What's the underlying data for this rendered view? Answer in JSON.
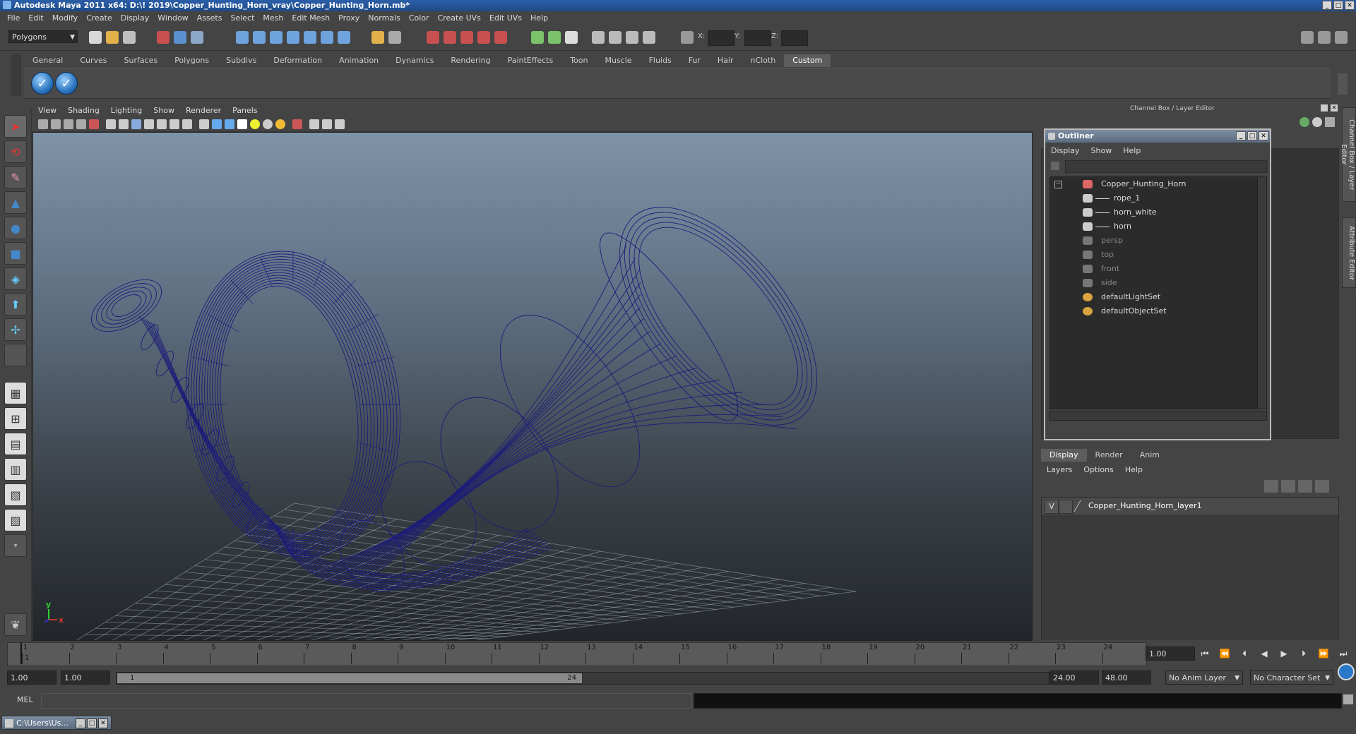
{
  "window": {
    "title": "Autodesk Maya 2011 x64: D:\\! 2019\\Copper_Hunting_Horn_vray\\Copper_Hunting_Horn.mb*",
    "buttons": [
      "_",
      "□",
      "✕"
    ]
  },
  "menubar": [
    "File",
    "Edit",
    "Modify",
    "Create",
    "Display",
    "Window",
    "Assets",
    "Select",
    "Mesh",
    "Edit Mesh",
    "Proxy",
    "Normals",
    "Color",
    "Create UVs",
    "Edit UVs",
    "Help"
  ],
  "statusline": {
    "mode": "Polygons",
    "coord_labels": [
      "X:",
      "Y:",
      "Z:"
    ]
  },
  "shelf": {
    "tabs": [
      "General",
      "Curves",
      "Surfaces",
      "Polygons",
      "Subdivs",
      "Deformation",
      "Animation",
      "Dynamics",
      "Rendering",
      "PaintEffects",
      "Toon",
      "Muscle",
      "Fluids",
      "Fur",
      "Hair",
      "nCloth",
      "Custom"
    ],
    "active_tab": "Custom"
  },
  "viewport": {
    "menu": [
      "View",
      "Shading",
      "Lighting",
      "Show",
      "Renderer",
      "Panels"
    ],
    "axis": {
      "y": "y",
      "x": "x"
    },
    "wire_color": "#1c1c7a",
    "grid_color": "#aab4c0"
  },
  "channel_box": {
    "title": "Channel Box / Layer Editor",
    "side_tabs": [
      "Channel Box / Layer Editor",
      "Attribute Editor"
    ]
  },
  "outliner": {
    "title": "Outliner",
    "menu": [
      "Display",
      "Show",
      "Help"
    ],
    "items": [
      {
        "label": "Copper_Hunting_Horn",
        "dim": false
      },
      {
        "label": "rope_1",
        "dim": false
      },
      {
        "label": "horn_white",
        "dim": false
      },
      {
        "label": "horn",
        "dim": false
      },
      {
        "label": "persp",
        "dim": true
      },
      {
        "label": "top",
        "dim": true
      },
      {
        "label": "front",
        "dim": true
      },
      {
        "label": "side",
        "dim": true
      },
      {
        "label": "defaultLightSet",
        "dim": false
      },
      {
        "label": "defaultObjectSet",
        "dim": false
      }
    ]
  },
  "layer_editor": {
    "tabs": [
      "Display",
      "Render",
      "Anim"
    ],
    "active_tab": "Display",
    "menu": [
      "Layers",
      "Options",
      "Help"
    ],
    "layer": {
      "visible": "V",
      "name": "Copper_Hunting_Horn_layer1"
    }
  },
  "timeline": {
    "frames": [
      "1",
      "2",
      "3",
      "4",
      "5",
      "6",
      "7",
      "8",
      "9",
      "10",
      "11",
      "12",
      "13",
      "14",
      "15",
      "16",
      "17",
      "18",
      "19",
      "20",
      "21",
      "22",
      "23",
      "24"
    ],
    "current_frame_marker": "1",
    "current_frame": "1.00"
  },
  "range": {
    "start": "1.00",
    "anim_start": "1.00",
    "handle_start": "1",
    "handle_end": "24",
    "anim_end": "24.00",
    "end": "48.00",
    "anim_layer": "No Anim Layer",
    "character_set": "No Character Set"
  },
  "command_line": {
    "label": "MEL"
  },
  "taskbar": {
    "item": "C:\\Users\\Us..."
  }
}
